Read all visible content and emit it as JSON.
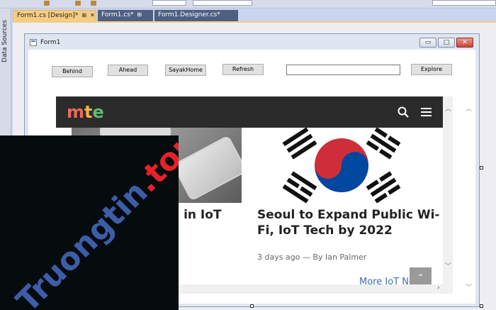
{
  "ide": {
    "side_panel_label": "Data Sources",
    "tabs": [
      {
        "label": "Form1.cs [Design]*",
        "active": true,
        "pin": "⊞",
        "close": "✕"
      },
      {
        "label": "Form1.cs*",
        "active": false,
        "pin": "⊞"
      },
      {
        "label": "Form1.Designer.cs*",
        "active": false
      }
    ]
  },
  "form": {
    "title": "Form1",
    "caption_buttons": {
      "minimize": "▭",
      "maximize": "□",
      "close": "✕"
    },
    "buttons": {
      "behind": "Behind",
      "ahead": "Ahead",
      "home": "SayakHome",
      "refresh": "Refresh",
      "explore": "Explore"
    },
    "address_value": ""
  },
  "web": {
    "logo": {
      "m": "m",
      "t": "t",
      "e": "e"
    },
    "posts": [
      {
        "title_line1": "d in IoT",
        "title_line2": ""
      },
      {
        "title_line1": "Seoul to Expand Public Wi-",
        "title_line2": "Fi, IoT Tech by 2022",
        "meta": "3 days ago — By Ian Palmer"
      }
    ],
    "more_link": "More IoT News",
    "back_top": "⌃"
  },
  "watermark": {
    "part1": "Truongtin",
    "part2": ".top"
  }
}
